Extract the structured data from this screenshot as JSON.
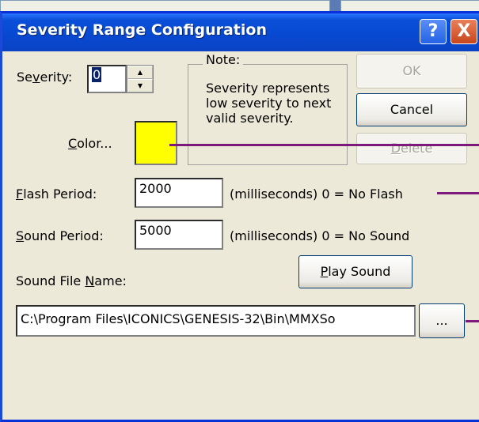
{
  "dialog": {
    "title": "Severity Range Configuration",
    "help_glyph": "?",
    "close_glyph": "X"
  },
  "severity": {
    "label_pre": "Se",
    "label_underline": "v",
    "label_post": "erity:",
    "value": "0"
  },
  "note": {
    "legend": "Note:",
    "text": "Severity represents low severity to next valid severity."
  },
  "buttons": {
    "ok": "OK",
    "cancel": "Cancel",
    "delete_pre": "",
    "delete_underline": "D",
    "delete_post": "elete",
    "color_pre": "",
    "color_underline": "C",
    "color_post": "olor...",
    "play_pre": "",
    "play_underline": "P",
    "play_post": "lay Sound",
    "browse": "..."
  },
  "flash": {
    "label_underline": "F",
    "label_post": "lash Period:",
    "value": "2000",
    "hint": "(milliseconds) 0 = No Flash"
  },
  "sound": {
    "label_underline": "S",
    "label_post": "ound Period:",
    "value": "5000",
    "hint": "(milliseconds) 0 = No Sound"
  },
  "sound_file": {
    "label_pre": "Sound File ",
    "label_underline": "N",
    "label_post": "ame:",
    "value": "C:\\Program Files\\ICONICS\\GENESIS-32\\Bin\\MMXSo"
  },
  "colors": {
    "swatch": "#ffff00",
    "callout": "#7b1a7b",
    "title_bar": "#0848d0"
  }
}
